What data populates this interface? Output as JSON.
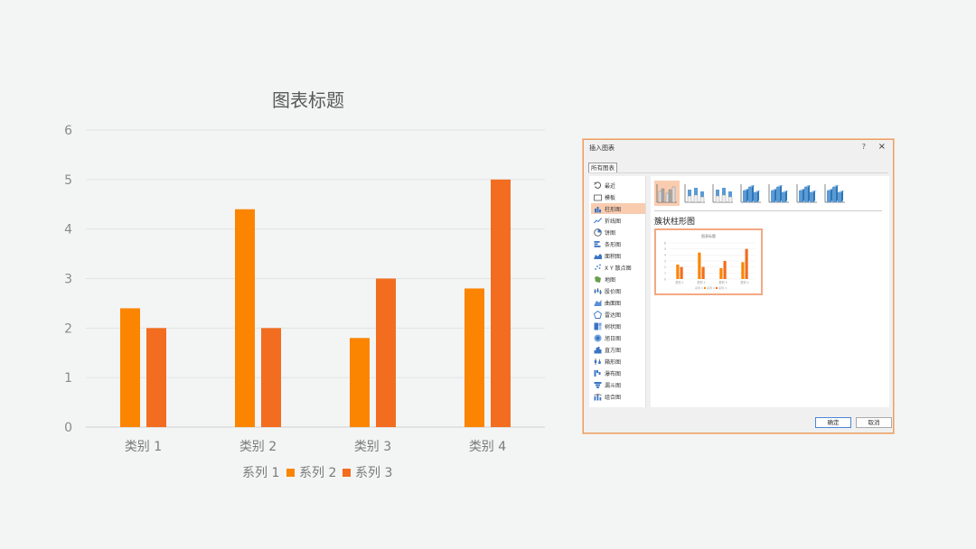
{
  "chart_data": {
    "type": "bar",
    "title": "图表标题",
    "categories": [
      "类别 1",
      "类别 2",
      "类别 3",
      "类别 4"
    ],
    "series": [
      {
        "name": "系列 1",
        "values": [
          0,
          0,
          0,
          0
        ],
        "color": "#4472c4"
      },
      {
        "name": "系列 2",
        "values": [
          2.4,
          4.4,
          1.8,
          2.8
        ],
        "color": "#fb8500"
      },
      {
        "name": "系列 3",
        "values": [
          2,
          2,
          3,
          5
        ],
        "color": "#f26d1f"
      }
    ],
    "ylim": [
      0,
      6
    ],
    "yticks": [
      0,
      1,
      2,
      3,
      4,
      5,
      6
    ],
    "grid": true,
    "legend_position": "bottom"
  },
  "dialog": {
    "title": "插入图表",
    "help": "?",
    "close": "×",
    "tab": "所有图表",
    "selected_type": "簇状柱形图",
    "ok": "确定",
    "cancel": "取消",
    "sidebar": [
      {
        "label": "最近",
        "icon": "recent-icon",
        "selected": false
      },
      {
        "label": "模板",
        "icon": "folder-icon",
        "selected": false
      },
      {
        "label": "柱形图",
        "icon": "column-chart-icon",
        "selected": true
      },
      {
        "label": "折线图",
        "icon": "line-chart-icon",
        "selected": false
      },
      {
        "label": "饼图",
        "icon": "pie-chart-icon",
        "selected": false
      },
      {
        "label": "条形图",
        "icon": "bar-chart-icon",
        "selected": false
      },
      {
        "label": "面积图",
        "icon": "area-chart-icon",
        "selected": false
      },
      {
        "label": "X Y 散点图",
        "icon": "scatter-chart-icon",
        "selected": false
      },
      {
        "label": "地图",
        "icon": "map-chart-icon",
        "selected": false
      },
      {
        "label": "股价图",
        "icon": "stock-chart-icon",
        "selected": false
      },
      {
        "label": "曲面图",
        "icon": "surface-chart-icon",
        "selected": false
      },
      {
        "label": "雷达图",
        "icon": "radar-chart-icon",
        "selected": false
      },
      {
        "label": "树状图",
        "icon": "treemap-chart-icon",
        "selected": false
      },
      {
        "label": "旭日图",
        "icon": "sunburst-chart-icon",
        "selected": false
      },
      {
        "label": "直方图",
        "icon": "histogram-chart-icon",
        "selected": false
      },
      {
        "label": "箱形图",
        "icon": "box-chart-icon",
        "selected": false
      },
      {
        "label": "瀑布图",
        "icon": "waterfall-chart-icon",
        "selected": false
      },
      {
        "label": "漏斗图",
        "icon": "funnel-chart-icon",
        "selected": false
      },
      {
        "label": "组合图",
        "icon": "combo-chart-icon",
        "selected": false
      }
    ],
    "subtypes": [
      {
        "name": "clustered-column-icon",
        "selected": true
      },
      {
        "name": "stacked-column-icon",
        "selected": false
      },
      {
        "name": "percent-stacked-column-icon",
        "selected": false
      },
      {
        "name": "3d-clustered-column-icon",
        "selected": false
      },
      {
        "name": "3d-stacked-column-icon",
        "selected": false
      },
      {
        "name": "3d-percent-stacked-column-icon",
        "selected": false
      },
      {
        "name": "3d-column-icon",
        "selected": false
      }
    ]
  }
}
